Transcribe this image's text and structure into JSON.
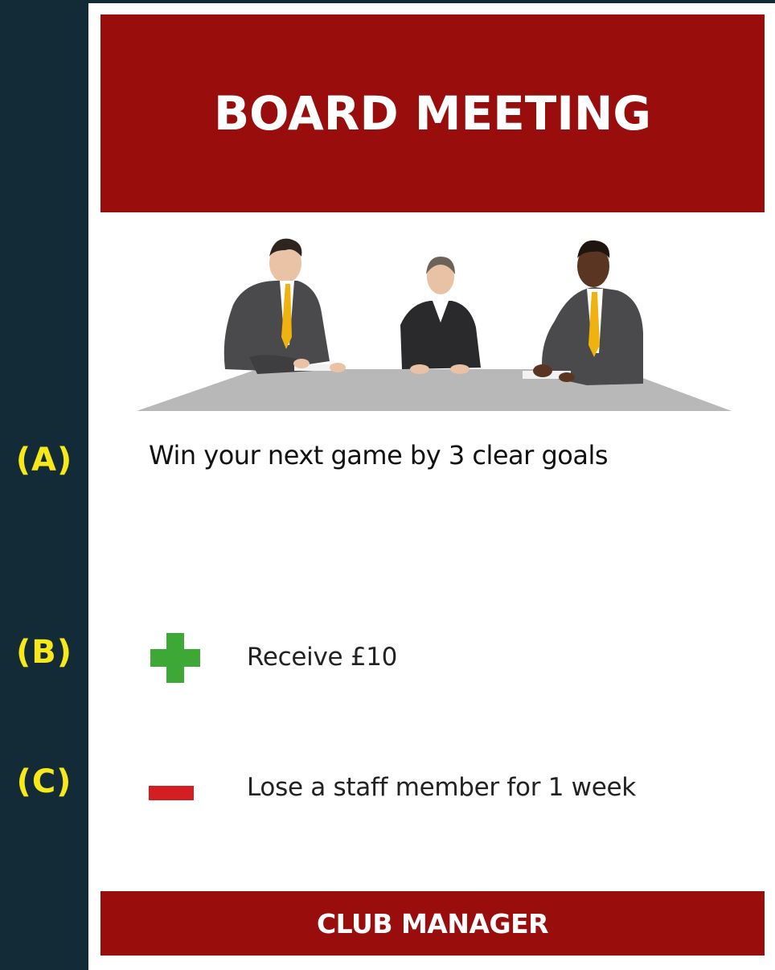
{
  "side_labels": {
    "a": "(A)",
    "b": "(B)",
    "c": "(C)"
  },
  "card": {
    "title": "BOARD MEETING",
    "illustration": "board-members-at-table-illustration",
    "objective": "Win your next game by 3 clear goals",
    "reward": {
      "icon": "plus-icon",
      "text": "Receive £10"
    },
    "penalty": {
      "icon": "minus-icon",
      "text": "Lose a staff member for 1 week"
    },
    "footer": "CLUB MANAGER"
  },
  "colors": {
    "background": "#132b37",
    "label_yellow": "#f7e81a",
    "brand_red": "#990d0d",
    "plus_green": "#3ea837",
    "minus_red": "#d41e22",
    "tie_yellow": "#f0b20f"
  }
}
